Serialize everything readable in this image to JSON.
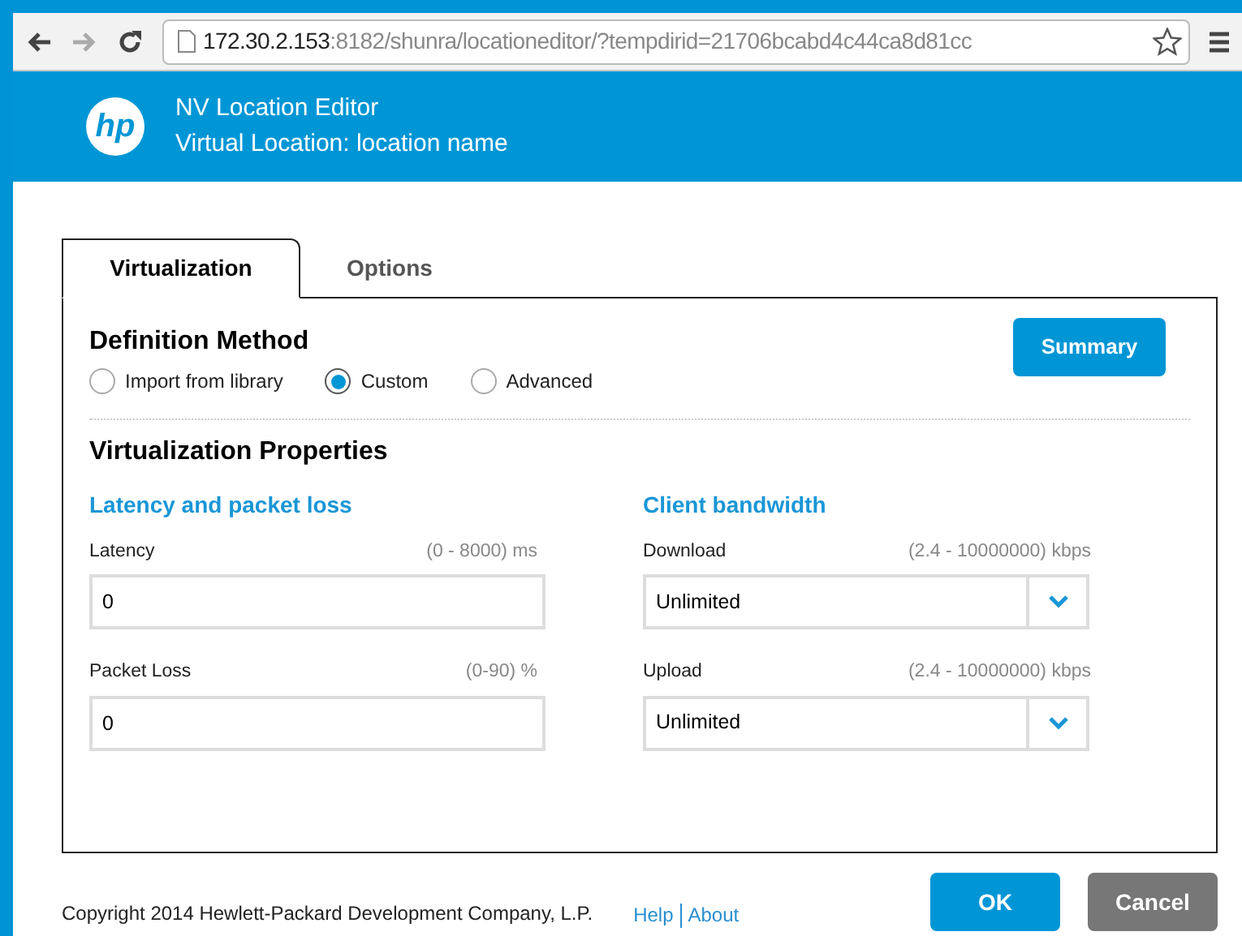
{
  "browser": {
    "url_host": "172.30.2.153",
    "url_rest": ":8182/shunra/locationeditor/?tempdirid=21706bcabd4c44ca8d81cc"
  },
  "header": {
    "logo": "hp",
    "title": "NV Location Editor",
    "subtitle": "Virtual Location: location name"
  },
  "tabs": [
    {
      "label": "Virtualization",
      "selected": true
    },
    {
      "label": "Options",
      "selected": false
    }
  ],
  "definition_method": {
    "title": "Definition Method",
    "summary_button": "Summary",
    "options": [
      {
        "label": "Import from library",
        "selected": false
      },
      {
        "label": "Custom",
        "selected": true
      },
      {
        "label": "Advanced",
        "selected": false
      }
    ]
  },
  "properties": {
    "title": "Virtualization Properties",
    "groups": [
      {
        "title": "Latency and packet loss",
        "fields": [
          {
            "kind": "text",
            "label": "Latency",
            "range": "(0 - 8000) ms",
            "value": "0"
          },
          {
            "kind": "text",
            "label": "Packet Loss",
            "range": "(0-90) %",
            "value": "0"
          }
        ]
      },
      {
        "title": "Client bandwidth",
        "fields": [
          {
            "kind": "dropdown",
            "label": "Download",
            "range": "(2.4 - 10000000) kbps",
            "value": "Unlimited"
          },
          {
            "kind": "dropdown",
            "label": "Upload",
            "range": "(2.4 - 10000000) kbps",
            "value": "Unlimited"
          }
        ]
      }
    ]
  },
  "footer": {
    "copyright": "Copyright 2014 Hewlett-Packard Development Company, L.P.",
    "links": [
      "Help",
      "About"
    ],
    "buttons": [
      {
        "kind": "primary",
        "label": "OK"
      },
      {
        "kind": "secondary",
        "label": "Cancel"
      }
    ]
  }
}
